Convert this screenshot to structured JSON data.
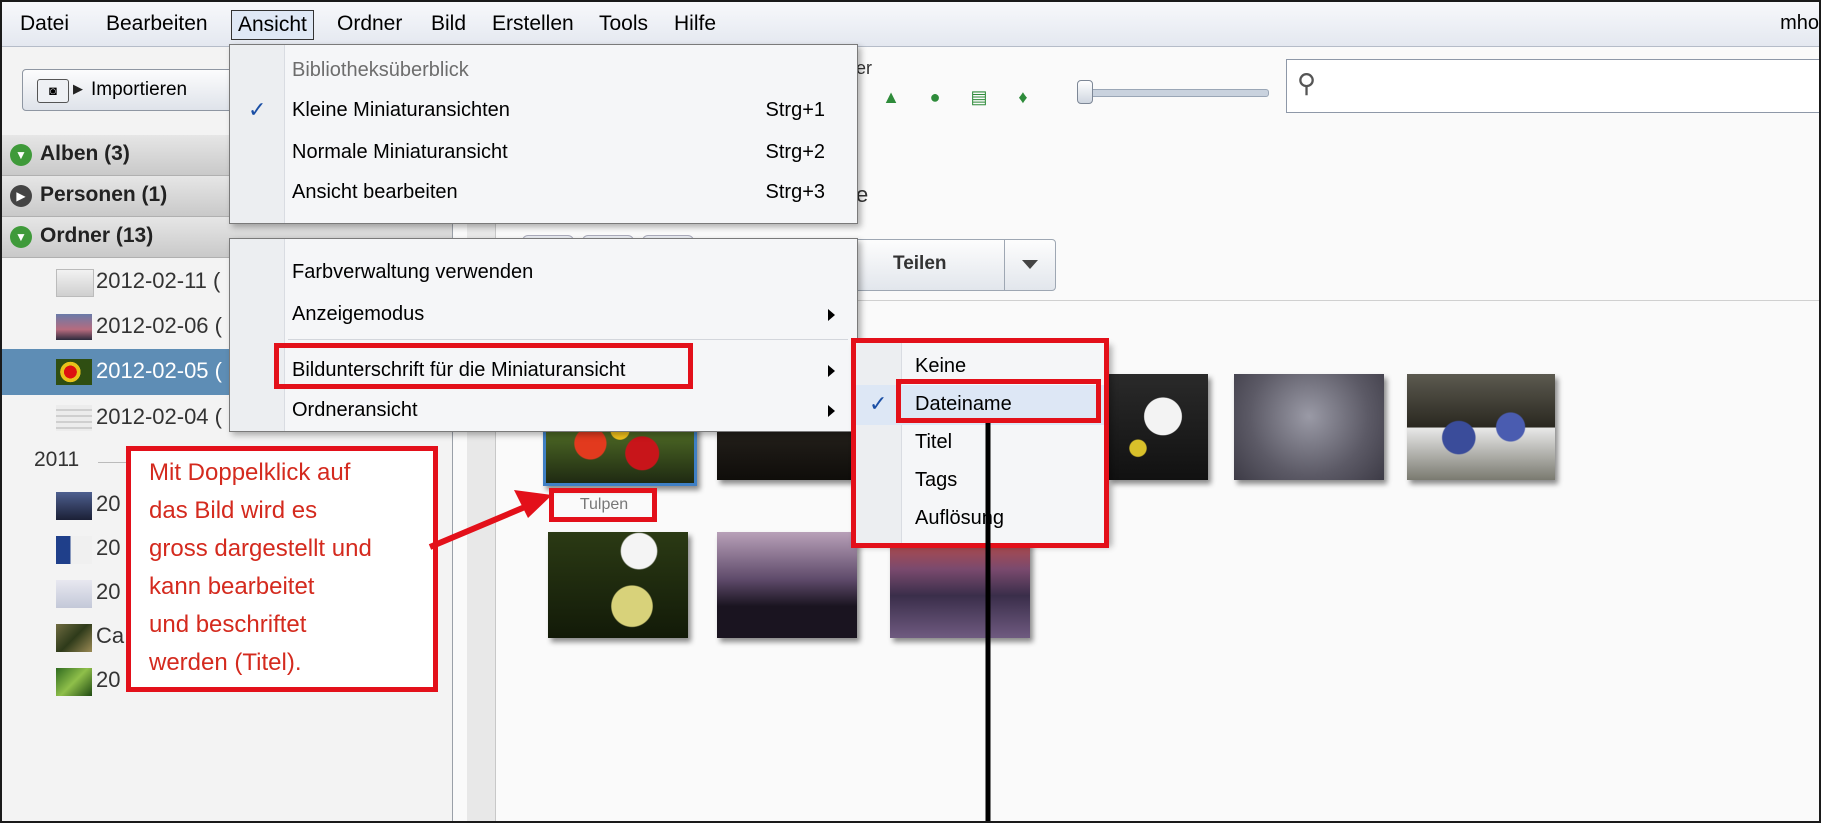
{
  "menubar": {
    "items": [
      "Datei",
      "Bearbeiten",
      "Ansicht",
      "Ordner",
      "Bild",
      "Erstellen",
      "Tools",
      "Hilfe"
    ],
    "user": "mho"
  },
  "toolbar": {
    "import_label": "Importieren",
    "toolbar_label_fragment": "er"
  },
  "sidebar": {
    "albums": "Alben (3)",
    "persons": "Personen (1)",
    "folders": "Ordner (13)",
    "folder_items": [
      "2012-02-11 (",
      "2012-02-06 (",
      "2012-02-05 (",
      "2012-02-04 ("
    ],
    "year": "2011",
    "year_items": [
      "20",
      "20",
      "20",
      "Ca",
      "20"
    ]
  },
  "main": {
    "share_label": "Teilen",
    "side_fragment": "e",
    "thumbnail_caption": "Tulpen"
  },
  "ansicht_menu": {
    "items": [
      {
        "label": "Bibliotheksüberblick",
        "shortcut": "",
        "checked": false,
        "disabled": true
      },
      {
        "label": "Kleine Miniaturansichten",
        "shortcut": "Strg+1",
        "checked": true,
        "disabled": false
      },
      {
        "label": "Normale Miniaturansicht",
        "shortcut": "Strg+2",
        "checked": false,
        "disabled": false
      },
      {
        "label": "Ansicht bearbeiten",
        "shortcut": "Strg+3",
        "checked": false,
        "disabled": false
      }
    ],
    "check_mark": "✓"
  },
  "view_options_menu": {
    "items": [
      {
        "label": "Farbverwaltung verwenden",
        "submenu": false
      },
      {
        "label": "Anzeigemodus",
        "submenu": true
      },
      {
        "label": "Bildunterschrift für die Miniaturansicht",
        "submenu": true
      },
      {
        "label": "Ordneransicht",
        "submenu": true
      }
    ]
  },
  "caption_submenu": {
    "items": [
      {
        "label": "Keine",
        "checked": false
      },
      {
        "label": "Dateiname",
        "checked": true
      },
      {
        "label": "Titel",
        "checked": false
      },
      {
        "label": "Tags",
        "checked": false
      },
      {
        "label": "Auflösung",
        "checked": false
      }
    ],
    "check_mark": "✓"
  },
  "annotation": {
    "lines": [
      "Mit Doppelklick auf",
      "das Bild wird es",
      "gross dargestellt und",
      "kann bearbeitet",
      "und beschriftet",
      "werden (Titel)."
    ],
    "color": "#e3101a"
  },
  "colors": {
    "accent": "#3f7fc4",
    "selection": "#5e8db5",
    "annotation": "#e3101a"
  }
}
